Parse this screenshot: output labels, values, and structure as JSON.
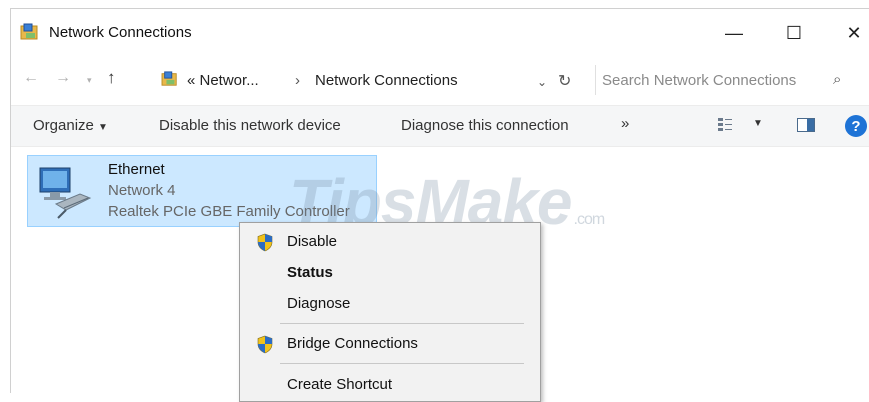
{
  "window": {
    "title": "Network Connections",
    "controls": {
      "minimize": "—",
      "maximize": "☐",
      "close": "✕"
    }
  },
  "address": {
    "crumb_prefix": "« Networ...",
    "separator": "›",
    "crumb_current": "Network Connections",
    "search_placeholder": "Search Network Connections"
  },
  "toolbar": {
    "organize": "Organize",
    "disable": "Disable this network device",
    "diagnose": "Diagnose this connection",
    "more": "»"
  },
  "item": {
    "name": "Ethernet",
    "network": "Network 4",
    "device": "Realtek PCIe GBE Family Controller"
  },
  "watermark": {
    "main": "TipsMake",
    "suffix": ".com"
  },
  "context_menu": {
    "items": [
      {
        "label": "Disable",
        "icon": "shield-icon",
        "bold": false
      },
      {
        "label": "Status",
        "icon": null,
        "bold": true
      },
      {
        "label": "Diagnose",
        "icon": null,
        "bold": false
      },
      {
        "label": "Bridge Connections",
        "icon": "shield-icon",
        "bold": false
      },
      {
        "label": "Create Shortcut",
        "icon": null,
        "bold": false
      }
    ]
  },
  "colors": {
    "selection": "#cce8ff",
    "selection_border": "#99d1ff",
    "help": "#1e73d6"
  }
}
